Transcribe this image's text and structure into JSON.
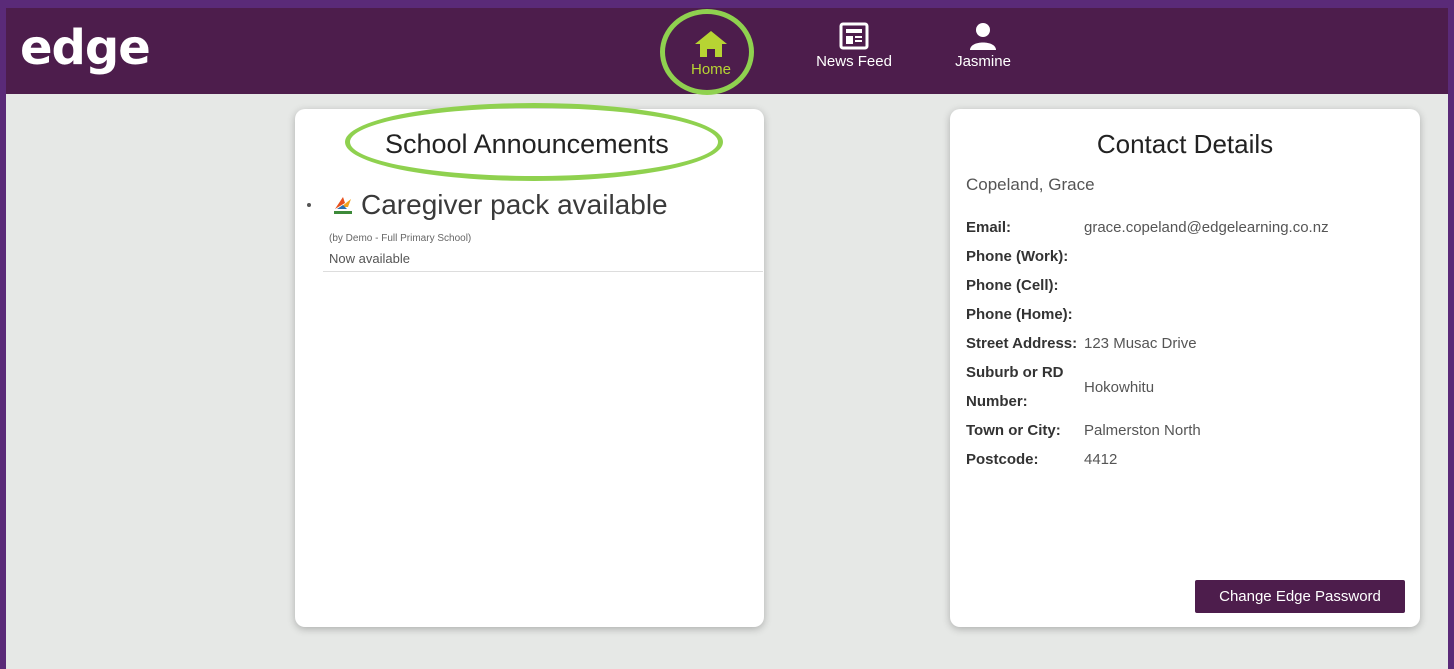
{
  "brand": {
    "logo_text": "edge",
    "accent": "#b7d433",
    "bar_color": "#4d1d4c"
  },
  "nav": {
    "items": [
      {
        "label": "Home",
        "icon": "home-icon",
        "active": true
      },
      {
        "label": "News Feed",
        "icon": "newspaper-icon",
        "active": false
      },
      {
        "label": "Jasmine",
        "icon": "user-icon",
        "active": false
      }
    ]
  },
  "announcements": {
    "title": "School Announcements",
    "items": [
      {
        "headline": "Caregiver pack available",
        "meta": "(by Demo - Full Primary School)",
        "body": "Now available"
      }
    ]
  },
  "contact": {
    "title": "Contact Details",
    "name": "Copeland, Grace",
    "fields": [
      {
        "label": "Email:",
        "value": "grace.copeland@edgelearning.co.nz"
      },
      {
        "label": "Phone (Work):",
        "value": ""
      },
      {
        "label": "Phone (Cell):",
        "value": ""
      },
      {
        "label": "Phone (Home):",
        "value": ""
      },
      {
        "label": "Street Address:",
        "value": "123 Musac Drive"
      },
      {
        "label": "Suburb or RD Number:",
        "value": "Hokowhitu"
      },
      {
        "label": "Town or City:",
        "value": "Palmerston North"
      },
      {
        "label": "Postcode:",
        "value": "4412"
      }
    ],
    "button_label": "Change Edge Password"
  }
}
